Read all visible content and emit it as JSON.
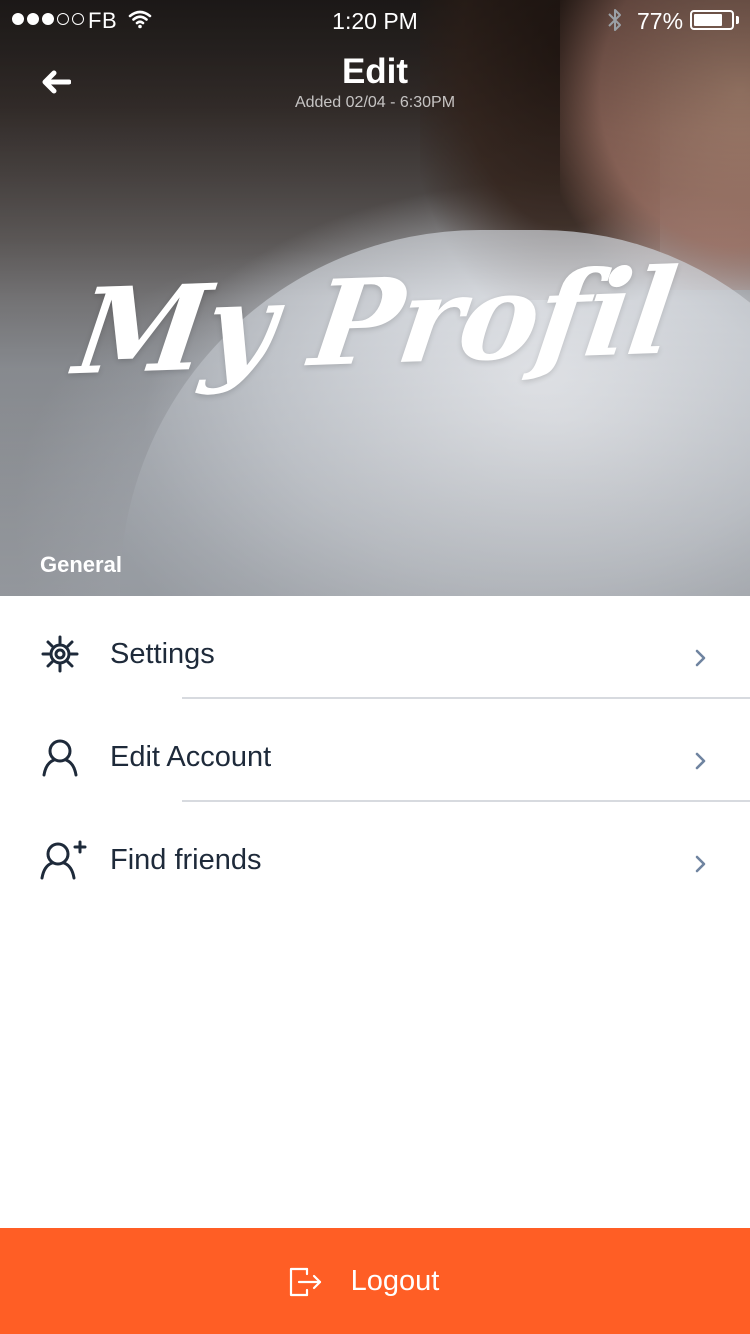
{
  "status_bar": {
    "carrier": "FB",
    "time": "1:20 PM",
    "battery_percent": "77%",
    "battery_level": 0.77,
    "signal_bars_filled": 3,
    "signal_bars_total": 5
  },
  "nav": {
    "title": "Edit",
    "subtitle": "Added 02/04 - 6:30PM",
    "back_icon": "arrow-left-icon"
  },
  "hero": {
    "script_title": "My Profil",
    "section_label": "General"
  },
  "menu": {
    "items": [
      {
        "label": "Settings",
        "icon": "settings-gear-icon"
      },
      {
        "label": "Edit Account",
        "icon": "user-icon"
      },
      {
        "label": "Find friends",
        "icon": "add-user-icon"
      }
    ]
  },
  "logout": {
    "label": "Logout",
    "icon": "logout-icon"
  },
  "colors": {
    "accent": "#ff5e25",
    "text_dark": "#1e2a3a",
    "chevron": "#6f84a0",
    "divider": "#d7dadf"
  }
}
